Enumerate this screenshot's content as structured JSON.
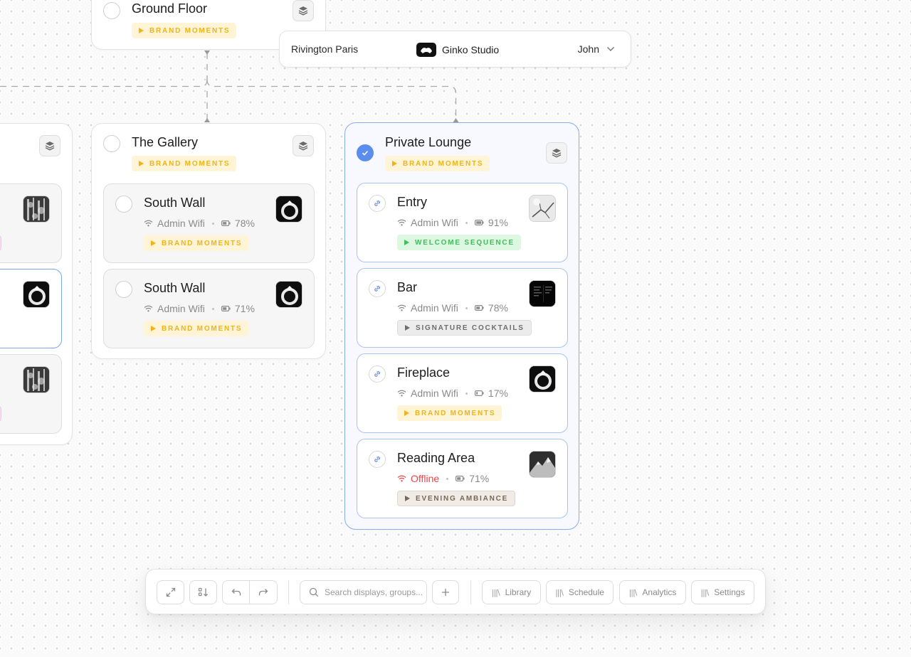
{
  "header": {
    "venue": "Rivington Paris",
    "brand_name": "Ginko Studio",
    "user": "John"
  },
  "groups": {
    "ground_floor": {
      "title": "Ground Floor",
      "tag": "BRAND MOMENTS"
    },
    "the_gallery": {
      "title": "The Gallery",
      "tag": "BRAND MOMENTS",
      "displays": [
        {
          "name": "South Wall",
          "network": "Admin Wifi",
          "battery": "78%",
          "tag": "BRAND MOMENTS",
          "thumb": "ring-photo"
        },
        {
          "name": "South Wall",
          "network": "Admin Wifi",
          "battery": "71%",
          "tag": "BRAND MOMENTS",
          "thumb": "ring-photo"
        }
      ]
    },
    "private_lounge": {
      "title": "Private Lounge",
      "tag": "BRAND MOMENTS",
      "selected": true,
      "displays": [
        {
          "name": "Entry",
          "network": "Admin Wifi",
          "battery": "91%",
          "tag": "WELCOME SEQUENCE",
          "tag_color": "green",
          "thumb": "snowy-branch-photo"
        },
        {
          "name": "Bar",
          "network": "Admin Wifi",
          "battery": "78%",
          "tag": "SIGNATURE COCKTAILS",
          "tag_color": "gray",
          "thumb": "menu-screen-photo"
        },
        {
          "name": "Fireplace",
          "network": "Admin Wifi",
          "battery": "17%",
          "tag": "BRAND MOMENTS",
          "tag_color": "yellow",
          "thumb": "ring-photo"
        },
        {
          "name": "Reading Area",
          "network": "Offline",
          "network_status": "offline",
          "battery": "71%",
          "tag": "EVENING AMBIANCE",
          "tag_color": "brown",
          "thumb": "mountain-photo"
        }
      ]
    },
    "left_partial": {
      "thumbs": [
        "forest-photo",
        "ring-photo",
        "forest-photo"
      ]
    }
  },
  "toolbar": {
    "search_placeholder": "Search displays, groups...",
    "nav": [
      {
        "label": "Library",
        "icon": "library-icon"
      },
      {
        "label": "Schedule",
        "icon": "library-icon"
      },
      {
        "label": "Analytics",
        "icon": "library-icon"
      },
      {
        "label": "Settings",
        "icon": "library-icon"
      }
    ],
    "nav_glyph": "|||\\"
  },
  "colors": {
    "accent_blue": "#5b8def",
    "tag_yellow": "#efb41c",
    "tag_green": "#47b960",
    "offline_red": "#ef4444"
  }
}
